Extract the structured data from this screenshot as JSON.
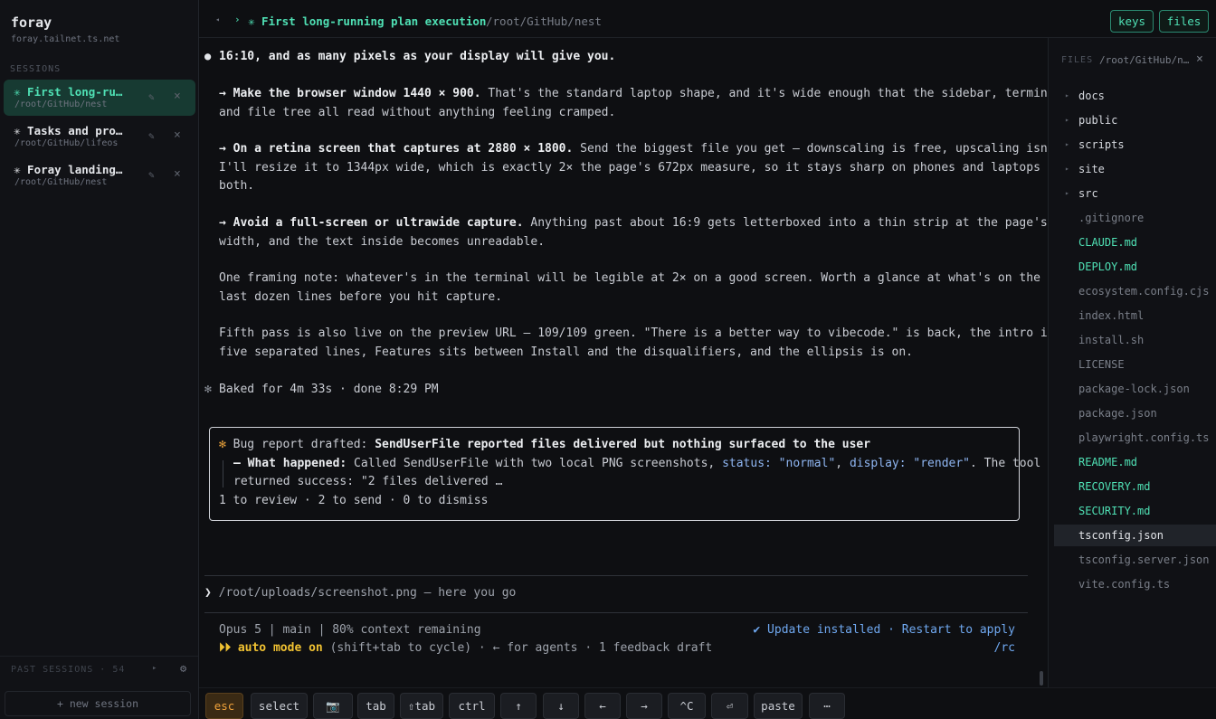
{
  "sidebar": {
    "brand": "foray",
    "host": "foray.tailnet.ts.net",
    "sessions_label": "SESSIONS",
    "sessions": [
      {
        "title": "✳ First long-ru…",
        "path": "/root/GitHub/nest",
        "active": true
      },
      {
        "title": "✳ Tasks and pro…",
        "path": "/root/GitHub/lifeos",
        "active": false
      },
      {
        "title": "✳ Foray landing…",
        "path": "/root/GitHub/nest",
        "active": false
      }
    ],
    "edit_glyph": "✎",
    "close_glyph": "×",
    "past_sessions_label": "PAST SESSIONS · 54",
    "past_arrow": "▸",
    "gear": "⚙",
    "new_session": "+ new session"
  },
  "header": {
    "back_glyph": "◂",
    "caret_glyph": "›",
    "title": "✳ First long-running plan execution",
    "path": "/root/GitHub/nest",
    "keys_button": "keys",
    "files_button": "files"
  },
  "transcript": {
    "l1": "16:10, and as many pixels as your display will give you.",
    "bullet": "●",
    "l2_bold": "→ Make the browser window 1440 × 900.",
    "l2_rest": " That's the standard laptop shape, and it's wide enough that the sidebar, terminal",
    "l3": "and file tree all read without anything feeling cramped.",
    "l4_bold": "→ On a retina screen that captures at 2880 × 1800.",
    "l4_rest": " Send the biggest file you get — downscaling is free, upscaling isn't.",
    "l5": "I'll resize it to 1344px wide, which is exactly 2× the page's 672px measure, so it stays sharp on phones and laptops",
    "l6": "both.",
    "l7_bold": "→ Avoid a full-screen or ultrawide capture.",
    "l7_rest": " Anything past about 16:9 gets letterboxed into a thin strip at the page's",
    "l8": "width, and the text inside becomes unreadable.",
    "l9": "One framing note: whatever's in the terminal will be legible at 2× on a good screen. Worth a glance at what's on the",
    "l10": "last dozen lines before you hit capture.",
    "l11": "Fifth pass is also live on the preview URL — 109/109 green. \"There is a better way to vibecode.\" is back, the intro is",
    "l12": "five separated lines, Features sits between Install and the disqualifiers, and the ellipsis is on.",
    "baked_star": "✻",
    "baked": "Baked for 4m 33s · done 8:29 PM"
  },
  "bug_card": {
    "star": "✻",
    "label": " Bug report drafted: ",
    "title": "SendUserFile reported files delivered but nothing surfaced to the user",
    "what_label": "– What happened:",
    "what_text": " Called SendUserFile with two local PNG screenshots, ",
    "status_key": "status: \"normal\"",
    "comma": ", ",
    "display_key": "display: \"render\"",
    "after": ". The tool",
    "line3": "returned success: \"2 files delivered …",
    "actions": "1 to review · 2 to send · 0 to dismiss"
  },
  "prompt": {
    "caret": "❯",
    "text": " /root/uploads/screenshot.png — here you go"
  },
  "status": {
    "line1": "Opus 5 | main | 80% context remaining",
    "auto_mode": "⏵⏵ auto mode on",
    "rest": " (shift+tab to cycle) · ← for agents · 1 feedback draft",
    "update": "✔ Update installed · Restart to apply",
    "rc": "/rc"
  },
  "files": {
    "header": "FILES",
    "path": "/root/GitHub/n…",
    "close": "×",
    "tri": "▸",
    "items": [
      {
        "name": "docs",
        "kind": "dir"
      },
      {
        "name": "public",
        "kind": "dir"
      },
      {
        "name": "scripts",
        "kind": "dir"
      },
      {
        "name": "site",
        "kind": "dir"
      },
      {
        "name": "src",
        "kind": "dir"
      },
      {
        "name": ".gitignore",
        "kind": "plain"
      },
      {
        "name": "CLAUDE.md",
        "kind": "md"
      },
      {
        "name": "DEPLOY.md",
        "kind": "md"
      },
      {
        "name": "ecosystem.config.cjs",
        "kind": "plain"
      },
      {
        "name": "index.html",
        "kind": "plain"
      },
      {
        "name": "install.sh",
        "kind": "plain"
      },
      {
        "name": "LICENSE",
        "kind": "plain"
      },
      {
        "name": "package-lock.json",
        "kind": "plain"
      },
      {
        "name": "package.json",
        "kind": "plain"
      },
      {
        "name": "playwright.config.ts",
        "kind": "plain"
      },
      {
        "name": "README.md",
        "kind": "md"
      },
      {
        "name": "RECOVERY.md",
        "kind": "md"
      },
      {
        "name": "SECURITY.md",
        "kind": "md"
      },
      {
        "name": "tsconfig.json",
        "kind": "selected"
      },
      {
        "name": "tsconfig.server.json",
        "kind": "plain"
      },
      {
        "name": "vite.config.ts",
        "kind": "plain"
      }
    ]
  },
  "keys": [
    "esc",
    "select",
    "📷",
    "tab",
    "⇧tab",
    "ctrl",
    "↑",
    "↓",
    "←",
    "→",
    "^C",
    "⏎",
    "paste",
    "⋯"
  ],
  "colors": {
    "accent": "#4fe0b4",
    "warning": "#f1c232",
    "link": "#6fa8f0",
    "esc": "#f0a23b"
  }
}
